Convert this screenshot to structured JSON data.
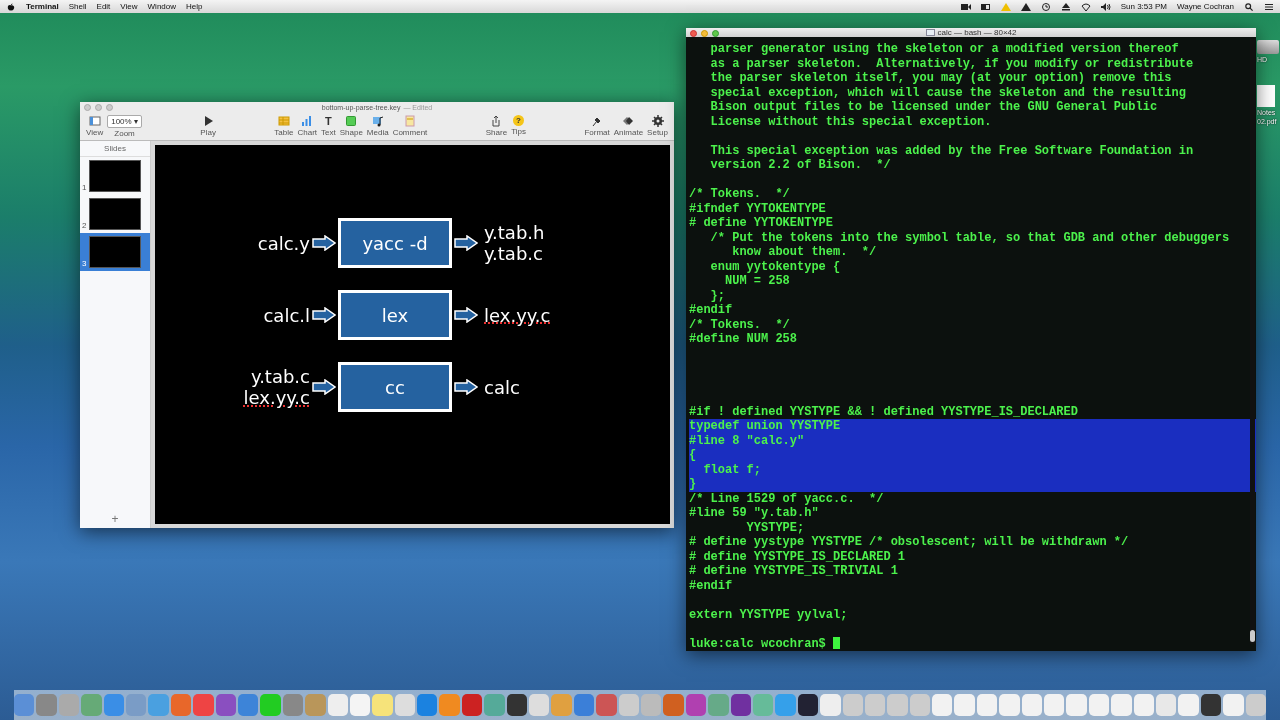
{
  "menu_bar": {
    "app": "Terminal",
    "menus": [
      "Shell",
      "Edit",
      "View",
      "Window",
      "Help"
    ],
    "clock": "Sun 3:53 PM",
    "user": "Wayne Cochran"
  },
  "desktop_items": [
    {
      "label": "HD"
    },
    {
      "label": "Notes"
    },
    {
      "label": "02.pdf"
    }
  ],
  "keynote": {
    "title": "bottom-up-parse-tree.key",
    "status": "— Edited",
    "toolbar": [
      {
        "items": [
          {
            "kind": "view",
            "label": "View"
          },
          {
            "kind": "zoom",
            "label": "Zoom",
            "value": "100%",
            "caret": "▾"
          }
        ]
      },
      {
        "items": [
          {
            "kind": "play",
            "label": "Play"
          }
        ]
      },
      {
        "items": [
          {
            "kind": "table",
            "label": "Table"
          },
          {
            "kind": "chart",
            "label": "Chart"
          },
          {
            "kind": "text",
            "label": "Text",
            "glyph": "T"
          },
          {
            "kind": "shape",
            "label": "Shape"
          },
          {
            "kind": "media",
            "label": "Media"
          },
          {
            "kind": "comment",
            "label": "Comment"
          }
        ]
      },
      {
        "items": [
          {
            "kind": "share",
            "label": "Share"
          },
          {
            "kind": "tips",
            "label": "Tips",
            "glyph": "?"
          }
        ]
      },
      {
        "items": [
          {
            "kind": "format",
            "label": "Format"
          },
          {
            "kind": "animate",
            "label": "Animate"
          },
          {
            "kind": "setup",
            "label": "Setup"
          }
        ]
      }
    ],
    "sidebar": {
      "title": "Slides",
      "add": "+",
      "slides": [
        {
          "number": "1",
          "selected": false
        },
        {
          "number": "2",
          "selected": false
        },
        {
          "number": "3",
          "selected": true
        }
      ]
    },
    "slide": {
      "rows": [
        {
          "inputs": [
            {
              "text": "calc.y",
              "misspelled": false
            }
          ],
          "box": "yacc -d",
          "outputs": [
            {
              "text": "y.tab.h",
              "misspelled": false
            },
            {
              "text": "y.tab.c",
              "misspelled": false
            }
          ]
        },
        {
          "inputs": [
            {
              "text": "calc.l",
              "misspelled": false
            }
          ],
          "box": "lex",
          "outputs": [
            {
              "text": "lex.yy.c",
              "misspelled": true
            }
          ]
        },
        {
          "inputs": [
            {
              "text": "y.tab.c",
              "misspelled": false
            },
            {
              "text": "lex.yy.c",
              "misspelled": true
            }
          ],
          "box": "cc",
          "outputs": [
            {
              "text": "calc",
              "misspelled": false
            }
          ]
        }
      ]
    }
  },
  "terminal": {
    "title": "calc — bash — 80×42",
    "lines": [
      {
        "kind": "code",
        "text": "   parser generator using the skeleton or a modified version thereof",
        "highlighted": false
      },
      {
        "kind": "code",
        "text": "   as a parser skeleton.  Alternatively, if you modify or redistribute",
        "highlighted": false
      },
      {
        "kind": "code",
        "text": "   the parser skeleton itself, you may (at your option) remove this",
        "highlighted": false
      },
      {
        "kind": "code",
        "text": "   special exception, which will cause the skeleton and the resulting",
        "highlighted": false
      },
      {
        "kind": "code",
        "text": "   Bison output files to be licensed under the GNU General Public",
        "highlighted": false
      },
      {
        "kind": "code",
        "text": "   License without this special exception.",
        "highlighted": false
      },
      {
        "kind": "blank"
      },
      {
        "kind": "code",
        "text": "   This special exception was added by the Free Software Foundation in",
        "highlighted": false
      },
      {
        "kind": "code",
        "text": "   version 2.2 of Bison.  */",
        "highlighted": false
      },
      {
        "kind": "blank"
      },
      {
        "kind": "code",
        "text": "/* Tokens.  */",
        "highlighted": false
      },
      {
        "kind": "code",
        "text": "#ifndef YYTOKENTYPE",
        "highlighted": false
      },
      {
        "kind": "code",
        "text": "# define YYTOKENTYPE",
        "highlighted": false
      },
      {
        "kind": "code",
        "text": "   /* Put the tokens into the symbol table, so that GDB and other debuggers",
        "highlighted": false
      },
      {
        "kind": "code",
        "text": "      know about them.  */",
        "highlighted": false
      },
      {
        "kind": "code",
        "text": "   enum yytokentype {",
        "highlighted": false
      },
      {
        "kind": "code",
        "text": "     NUM = 258",
        "highlighted": false
      },
      {
        "kind": "code",
        "text": "   };",
        "highlighted": false
      },
      {
        "kind": "code",
        "text": "#endif",
        "highlighted": false
      },
      {
        "kind": "code",
        "text": "/* Tokens.  */",
        "highlighted": false
      },
      {
        "kind": "code",
        "text": "#define NUM 258",
        "highlighted": false
      },
      {
        "kind": "blank"
      },
      {
        "kind": "blank"
      },
      {
        "kind": "blank"
      },
      {
        "kind": "blank"
      },
      {
        "kind": "code",
        "text": "#if ! defined YYSTYPE && ! defined YYSTYPE_IS_DECLARED",
        "highlighted": false
      },
      {
        "kind": "code",
        "text": "typedef union YYSTYPE",
        "highlighted": true
      },
      {
        "kind": "code",
        "text": "#line 8 \"calc.y\"",
        "highlighted": true
      },
      {
        "kind": "code",
        "text": "{",
        "highlighted": true
      },
      {
        "kind": "code",
        "text": "  float f;",
        "highlighted": true
      },
      {
        "kind": "code",
        "text": "}",
        "highlighted": true
      },
      {
        "kind": "code",
        "text": "/* Line 1529 of yacc.c.  */",
        "highlighted": false
      },
      {
        "kind": "code",
        "text": "#line 59 \"y.tab.h\"",
        "highlighted": false
      },
      {
        "kind": "code",
        "text": "        YYSTYPE;",
        "highlighted": false
      },
      {
        "kind": "code",
        "text": "# define yystype YYSTYPE /* obsolescent; will be withdrawn */",
        "highlighted": false
      },
      {
        "kind": "code",
        "text": "# define YYSTYPE_IS_DECLARED 1",
        "highlighted": false
      },
      {
        "kind": "code",
        "text": "# define YYSTYPE_IS_TRIVIAL 1",
        "highlighted": false
      },
      {
        "kind": "code",
        "text": "#endif",
        "highlighted": false
      },
      {
        "kind": "blank"
      },
      {
        "kind": "code",
        "text": "extern YYSTYPE yylval;",
        "highlighted": false
      },
      {
        "kind": "blank"
      },
      {
        "kind": "prompt",
        "text": "luke:calc wcochran$ ",
        "highlighted": false
      }
    ]
  }
}
